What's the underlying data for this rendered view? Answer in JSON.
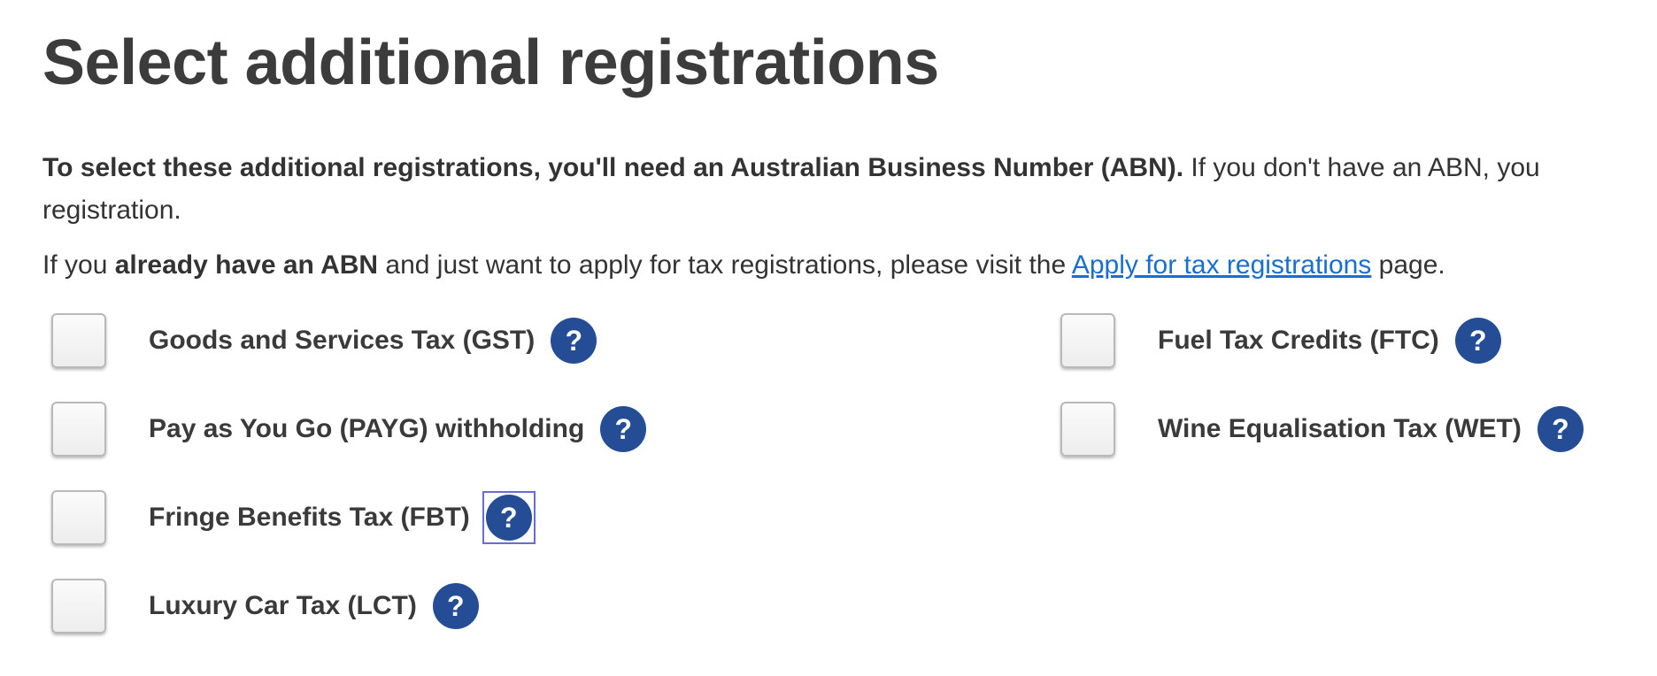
{
  "page": {
    "title": "Select additional registrations"
  },
  "intro": {
    "bold": "To select these additional registrations, you'll need an Australian Business Number (ABN).",
    "rest": " If you don't have an ABN, you",
    "line2": "registration."
  },
  "abn_note": {
    "prefix": "If you ",
    "bold": "already have an ABN",
    "middle": " and just want to apply for tax registrations, please visit the ",
    "link": "Apply for tax registrations",
    "suffix": " page."
  },
  "help_icon": {
    "glyph": "?",
    "icon": "help-icon",
    "color": "#254d96"
  },
  "options": {
    "gst": {
      "label": "Goods and Services Tax (GST)",
      "checked": false
    },
    "payg": {
      "label": "Pay as You Go (PAYG) withholding",
      "checked": false
    },
    "fbt": {
      "label": "Fringe Benefits Tax (FBT)",
      "checked": false
    },
    "lct": {
      "label": "Luxury Car Tax (LCT)",
      "checked": false
    },
    "ftc": {
      "label": "Fuel Tax Credits (FTC)",
      "checked": false
    },
    "wet": {
      "label": "Wine Equalisation Tax (WET)",
      "checked": false
    }
  },
  "colors": {
    "link": "#1a6ecf",
    "focus_outline": "#6b6bd6"
  }
}
